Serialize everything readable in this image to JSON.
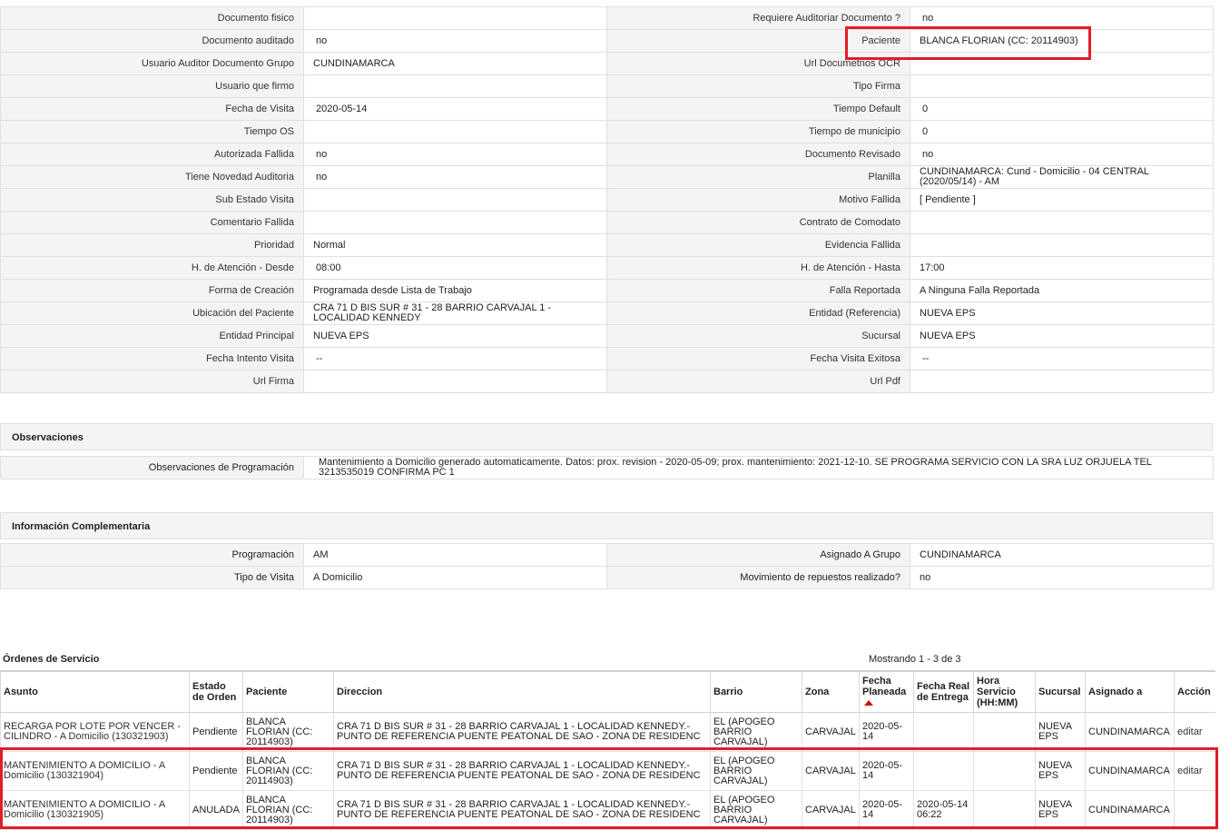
{
  "details": {
    "rows": [
      [
        "Documento fisico",
        "",
        "Requiere Auditoriar Documento ?",
        "no"
      ],
      [
        "Documento auditado",
        "no",
        "Paciente",
        "BLANCA FLORIAN (CC: 20114903)"
      ],
      [
        "Usuario Auditor Documento Grupo",
        "CUNDINAMARCA",
        "Url Documetnos OCR",
        ""
      ],
      [
        "Usuario que firmo",
        "",
        "Tipo Firma",
        ""
      ],
      [
        "Fecha de Visita",
        "2020-05-14",
        "Tiempo Default",
        "0"
      ],
      [
        "Tiempo OS",
        "",
        "Tiempo de municipio",
        "0"
      ],
      [
        "Autorizada Fallida",
        "no",
        "Documento Revisado",
        "no"
      ],
      [
        "Tiene Novedad Auditoria",
        "no",
        "Planilla",
        "CUNDINAMARCA: Cund - Domicilio - 04 CENTRAL (2020/05/14) - AM"
      ],
      [
        "Sub Estado Visita",
        "",
        "Motivo Fallida",
        "[ Pendiente ]"
      ],
      [
        "Comentario Fallida",
        "",
        "Contrato de Comodato",
        ""
      ],
      [
        "Prioridad",
        "Normal",
        "Evidencia Fallida",
        ""
      ],
      [
        "H. de Atención - Desde",
        "08:00",
        "H. de Atención - Hasta",
        "17:00"
      ],
      [
        "Forma de Creación",
        "Programada desde Lista de Trabajo",
        "Falla Reportada",
        "A Ninguna Falla Reportada"
      ],
      [
        "Ubicación del Paciente",
        "CRA 71 D BIS SUR # 31 - 28 BARRIO CARVAJAL 1 - LOCALIDAD KENNEDY",
        "Entidad (Referencia)",
        "NUEVA EPS"
      ],
      [
        "Entidad Principal",
        "NUEVA EPS",
        "Sucursal",
        "NUEVA EPS"
      ],
      [
        "Fecha Intento Visita",
        "--",
        "Fecha Visita Exitosa",
        "--"
      ],
      [
        "Url Firma",
        "",
        "Url Pdf",
        ""
      ]
    ]
  },
  "observaciones": {
    "title": "Observaciones",
    "label": "Observaciones de Programación",
    "value": "Mantenimiento a Domicilio generado automaticamente. Datos: prox. revision - 2020-05-09; prox. mantenimiento: 2021-12-10. SE PROGRAMA SERVICIO CON LA SRA LUZ ORJUELA TEL 3213535019 CONFIRMA PC 1"
  },
  "info": {
    "title": "Información Complementaria",
    "rows": [
      [
        "Programación",
        "AM",
        "Asignado A Grupo",
        "CUNDINAMARCA"
      ],
      [
        "Tipo de Visita",
        "A Domicilio",
        "Movimiento de repuestos realizado?",
        "no"
      ]
    ]
  },
  "orders": {
    "title": "Órdenes de Servicio",
    "count": "Mostrando 1 - 3 de 3",
    "headers": [
      "Asunto",
      "Estado de Orden",
      "Paciente",
      "Direccion",
      "Barrio",
      "Zona",
      "Fecha Planeada",
      "Fecha Real de Entrega",
      "Hora Servicio (HH:MM)",
      "Sucursal",
      "Asignado a",
      "Acción"
    ],
    "rows": [
      [
        "RECARGA POR LOTE POR VENCER - CILINDRO - A Domicilio (130321903)",
        "Pendiente",
        "BLANCA FLORIAN (CC: 20114903)",
        "CRA 71 D BIS SUR # 31 - 28 BARRIO CARVAJAL 1 - LOCALIDAD KENNEDY.- PUNTO DE REFERENCIA PUENTE PEATONAL DE SAO - ZONA DE RESIDENC",
        "EL (APOGEO BARRIO CARVAJAL)",
        "CARVAJAL",
        "2020-05-14",
        "",
        "",
        "NUEVA EPS",
        "CUNDINAMARCA",
        "editar"
      ],
      [
        "MANTENIMIENTO A DOMICILIO - A Domicilio (130321904)",
        "Pendiente",
        "BLANCA FLORIAN (CC: 20114903)",
        "CRA 71 D BIS SUR # 31 - 28 BARRIO CARVAJAL 1 - LOCALIDAD KENNEDY.- PUNTO DE REFERENCIA PUENTE PEATONAL DE SAO - ZONA DE RESIDENC",
        "EL (APOGEO BARRIO CARVAJAL)",
        "CARVAJAL",
        "2020-05-14",
        "",
        "",
        "NUEVA EPS",
        "CUNDINAMARCA",
        "editar"
      ],
      [
        "MANTENIMIENTO A DOMICILIO - A Domicilio (130321905)",
        "ANULADA",
        "BLANCA FLORIAN (CC: 20114903)",
        "CRA 71 D BIS SUR # 31 - 28 BARRIO CARVAJAL 1 - LOCALIDAD KENNEDY.- PUNTO DE REFERENCIA PUENTE PEATONAL DE SAO - ZONA DE RESIDENC",
        "EL (APOGEO BARRIO CARVAJAL)",
        "CARVAJAL",
        "2020-05-14",
        "2020-05-14 06:22",
        "",
        "NUEVA EPS",
        "CUNDINAMARCA",
        ""
      ]
    ]
  },
  "colors": {
    "highlight": "#e11d2a",
    "label_bg": "#f4f4f4",
    "border": "#e0e0e0",
    "sort_arrow": "#cc1111"
  }
}
